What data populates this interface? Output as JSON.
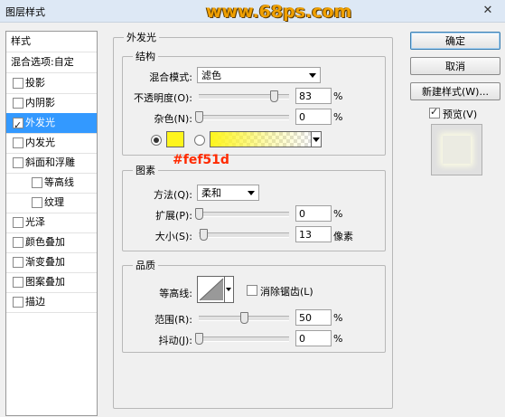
{
  "window": {
    "title": "图层样式",
    "close": "✕"
  },
  "watermark": "www.68ps.com",
  "sidebar": {
    "header": "样式",
    "blend_options": "混合选项:自定",
    "items": [
      {
        "label": "投影",
        "checked": false
      },
      {
        "label": "内阴影",
        "checked": false
      },
      {
        "label": "外发光",
        "checked": true,
        "selected": true
      },
      {
        "label": "内发光",
        "checked": false
      },
      {
        "label": "斜面和浮雕",
        "checked": false
      },
      {
        "label": "等高线",
        "checked": false,
        "sub": true
      },
      {
        "label": "纹理",
        "checked": false,
        "sub": true
      },
      {
        "label": "光泽",
        "checked": false
      },
      {
        "label": "颜色叠加",
        "checked": false
      },
      {
        "label": "渐变叠加",
        "checked": false
      },
      {
        "label": "图案叠加",
        "checked": false
      },
      {
        "label": "描边",
        "checked": false
      }
    ]
  },
  "outer_glow": {
    "title": "外发光",
    "structure": {
      "title": "结构",
      "blend_mode_label": "混合模式:",
      "blend_mode_value": "滤色",
      "opacity_label": "不透明度(O):",
      "opacity_value": "83",
      "opacity_fraction": 0.83,
      "noise_label": "杂色(N):",
      "noise_value": "0",
      "noise_fraction": 0.0,
      "percent": "%",
      "glow_color": "#fef51d"
    },
    "color_annotation": "#fef51d",
    "elements": {
      "title": "图素",
      "method_label": "方法(Q):",
      "method_value": "柔和",
      "spread_label": "扩展(P):",
      "spread_value": "0",
      "spread_fraction": 0.0,
      "size_label": "大小(S):",
      "size_value": "13",
      "size_fraction": 0.052,
      "pixels": "像素",
      "percent": "%"
    },
    "quality": {
      "title": "品质",
      "contour_label": "等高线:",
      "antialias_label": "消除锯齿(L)",
      "antialias_checked": false,
      "range_label": "范围(R):",
      "range_value": "50",
      "range_fraction": 0.5,
      "jitter_label": "抖动(J):",
      "jitter_value": "0",
      "jitter_fraction": 0.0,
      "percent": "%"
    }
  },
  "buttons": {
    "ok": "确定",
    "cancel": "取消",
    "new_style": "新建样式(W)...",
    "preview": "预览(V)",
    "preview_checked": true
  },
  "colors": {
    "selection": "#3399ff",
    "annotation": "#ff2a00",
    "glow": "#fef51d"
  }
}
